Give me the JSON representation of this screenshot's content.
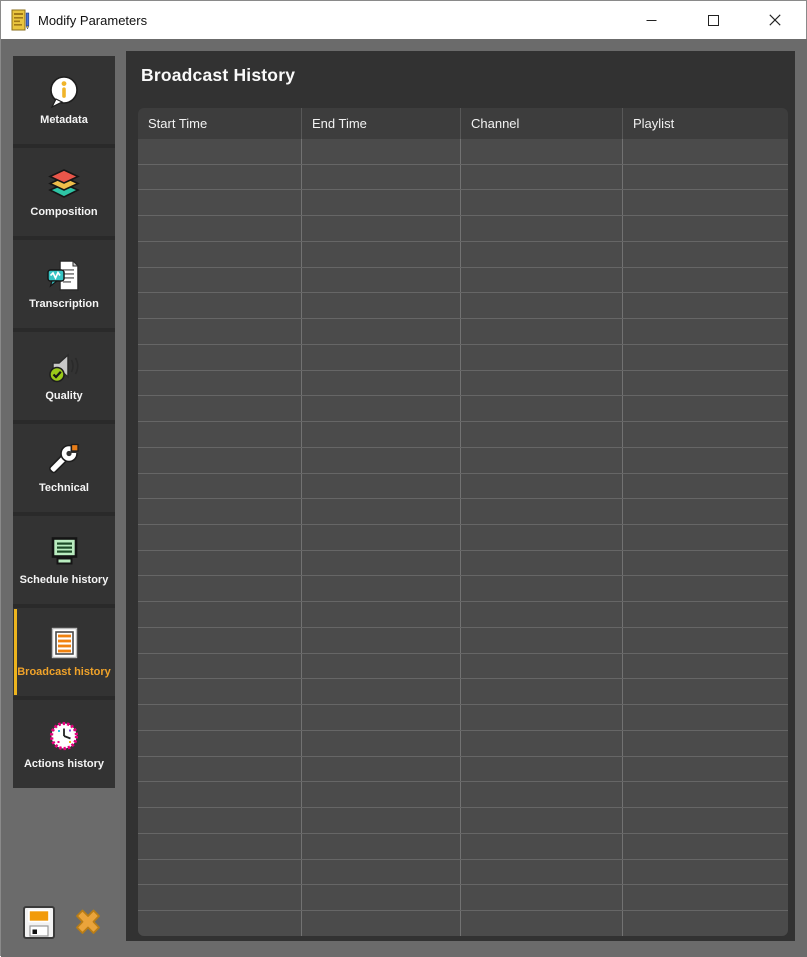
{
  "window": {
    "title": "Modify Parameters"
  },
  "titlebar": {
    "app_icon": "document-note-icon",
    "controls": [
      {
        "name": "minimize-button",
        "icon": "minimize-icon"
      },
      {
        "name": "maximize-button",
        "icon": "maximize-icon"
      },
      {
        "name": "close-button",
        "icon": "close-icon"
      }
    ]
  },
  "sidebar": {
    "items": [
      {
        "label": "Metadata",
        "icon": "info-bubble-icon",
        "selected": false
      },
      {
        "label": "Composition",
        "icon": "layers-icon",
        "selected": false
      },
      {
        "label": "Transcription",
        "icon": "document-speech-icon",
        "selected": false
      },
      {
        "label": "Quality",
        "icon": "speaker-check-icon",
        "selected": false
      },
      {
        "label": "Technical",
        "icon": "wrench-icon",
        "selected": false
      },
      {
        "label": "Schedule history",
        "icon": "screen-list-green-icon",
        "selected": false
      },
      {
        "label": "Broadcast history",
        "icon": "list-orange-icon",
        "selected": true
      },
      {
        "label": "Actions history",
        "icon": "clock-icon",
        "selected": false
      }
    ]
  },
  "actions": {
    "save": {
      "icon": "save-floppy-icon"
    },
    "cancel": {
      "icon": "cancel-x-icon"
    }
  },
  "main": {
    "heading": "Broadcast History",
    "table": {
      "columns": [
        "Start Time",
        "End Time",
        "Channel",
        "Playlist"
      ],
      "rows": [],
      "empty_row_count": 31
    }
  },
  "colors": {
    "titlebar_bg": "#ffffff",
    "client_bg": "#6b6b6b",
    "panel_bg": "#323232",
    "button_bg": "#333333",
    "button_gap": "#2a2a2a",
    "table_header_bg": "#3d3d3d",
    "table_row_bg": "#4b4b4b",
    "row_line": "#666666",
    "accent_yellow": "#edb41e",
    "selected_text": "#f0a32a",
    "label_text": "#f5f5f5"
  }
}
